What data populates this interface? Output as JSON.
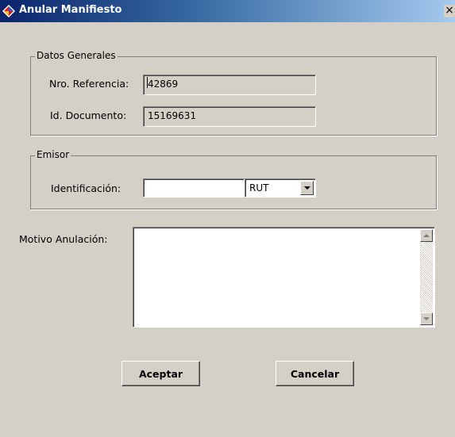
{
  "window": {
    "title": "Anular Manifiesto",
    "close_glyph": "×",
    "title_icon": "app-diamond-icon"
  },
  "datos_generales": {
    "legend": "Datos Generales",
    "nro_referencia_label": "Nro. Referencia:",
    "nro_referencia_value": "42869",
    "id_documento_label": "Id. Documento:",
    "id_documento_value": "15169631"
  },
  "emisor": {
    "legend": "Emisor",
    "identificacion_label": "Identificación:",
    "identificacion_value": "",
    "tipo_selected": "RUT"
  },
  "motivo": {
    "label": "Motivo Anulación:",
    "value": ""
  },
  "buttons": {
    "aceptar": "Aceptar",
    "cancelar": "Cancelar"
  },
  "colors": {
    "dialog_bg": "#d4d0c8",
    "title_start": "#0a246a",
    "title_end": "#a6caf0"
  }
}
